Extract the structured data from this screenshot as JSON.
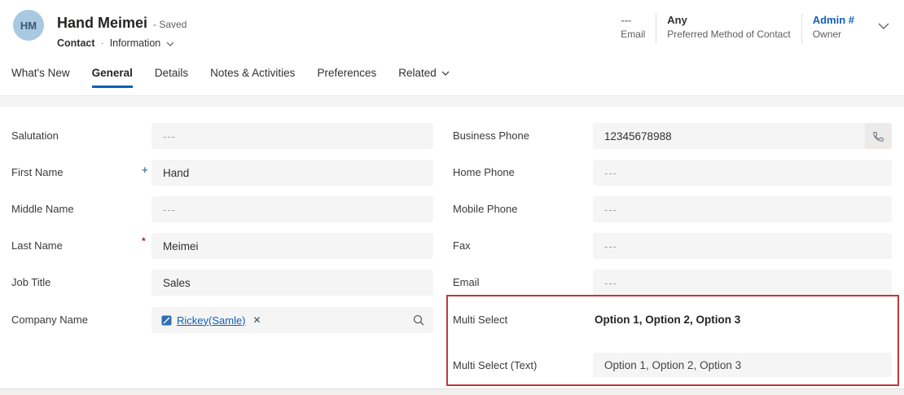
{
  "colors": {
    "accent": "#1160b7",
    "link": "#1160b7",
    "required_marker": "#a4262c",
    "recommended_marker": "#4f84b1",
    "highlight_border": "#c0393b",
    "avatar_bg": "#a9c8e1",
    "field_bg": "#f5f5f5"
  },
  "icons": {
    "close": "✕",
    "separator": "·"
  },
  "header": {
    "avatar_initials": "HM",
    "title": "Hand Meimei",
    "save_status": "- Saved",
    "entity": "Contact",
    "form_name": "Information",
    "summary": [
      {
        "value": "---",
        "label": "Email"
      },
      {
        "value": "Any",
        "label": "Preferred Method of Contact"
      },
      {
        "value": "Admin #",
        "label": "Owner"
      }
    ]
  },
  "tabs": [
    {
      "label": "What's New"
    },
    {
      "label": "General"
    },
    {
      "label": "Details"
    },
    {
      "label": "Notes & Activities"
    },
    {
      "label": "Preferences"
    },
    {
      "label": "Related"
    }
  ],
  "form": {
    "left": [
      {
        "label": "Salutation",
        "placeholder": "---"
      },
      {
        "label": "First Name",
        "marker": "+",
        "value": "Hand"
      },
      {
        "label": "Middle Name",
        "placeholder": "---"
      },
      {
        "label": "Last Name",
        "marker": "*",
        "value": "Meimei"
      },
      {
        "label": "Job Title",
        "value": "Sales"
      },
      {
        "label": "Company Name",
        "lookup_value": "Rickey(Samle)"
      }
    ],
    "right": [
      {
        "label": "Business Phone",
        "value": "12345678988"
      },
      {
        "label": "Home Phone",
        "placeholder": "---"
      },
      {
        "label": "Mobile Phone",
        "placeholder": "---"
      },
      {
        "label": "Fax",
        "placeholder": "---"
      },
      {
        "label": "Email",
        "placeholder": "---"
      },
      {
        "label": "Multi Select",
        "value": "Option 1, Option 2, Option 3"
      },
      {
        "label": "Multi Select (Text)",
        "value": "Option 1, Option 2, Option 3"
      }
    ]
  }
}
